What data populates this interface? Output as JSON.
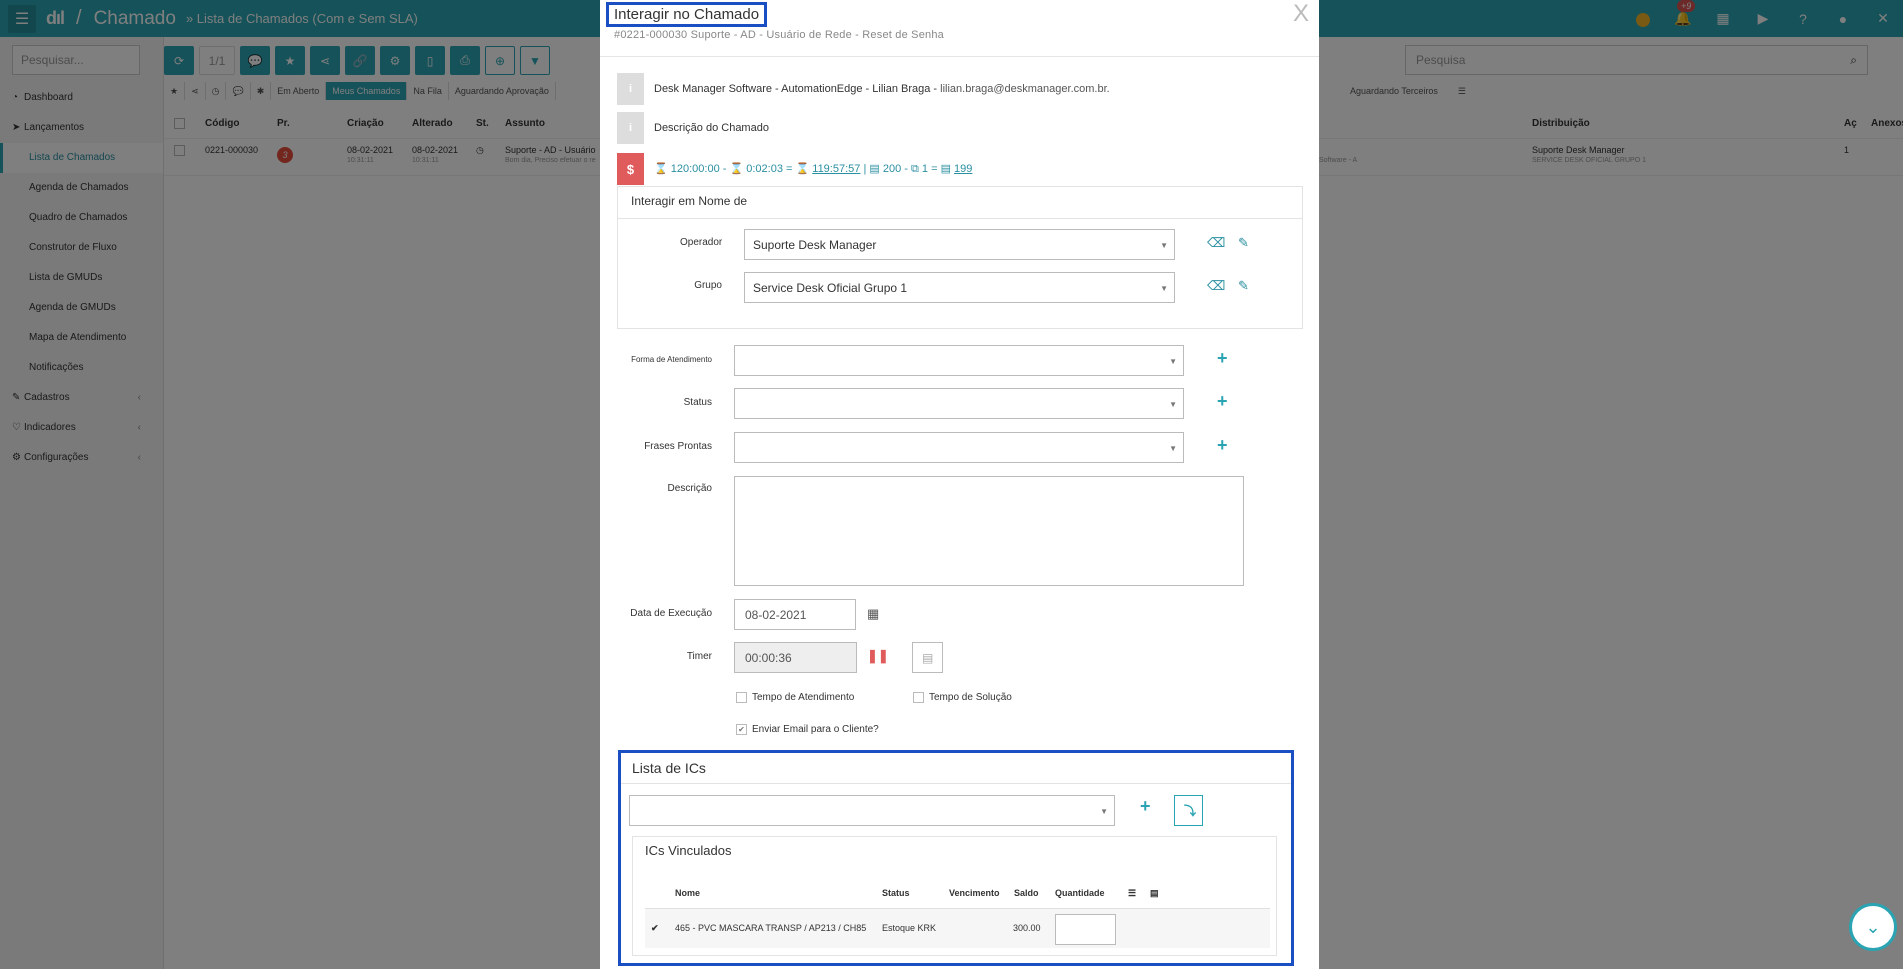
{
  "header": {
    "logo": "dıl",
    "separator": "/",
    "title": "Chamado",
    "breadcrumb": "» Lista de Chamados (Com e Sem SLA)",
    "notification_count": "+9"
  },
  "sidebar": {
    "search_placeholder": "Pesquisar...",
    "items": [
      {
        "label": "Dashboard"
      },
      {
        "label": "Lançamentos"
      },
      {
        "label": "Lista de Chamados"
      },
      {
        "label": "Agenda de Chamados"
      },
      {
        "label": "Quadro de Chamados"
      },
      {
        "label": "Construtor de Fluxo"
      },
      {
        "label": "Lista de GMUDs"
      },
      {
        "label": "Agenda de GMUDs"
      },
      {
        "label": "Mapa de Atendimento"
      },
      {
        "label": "Notificações"
      },
      {
        "label": "Cadastros"
      },
      {
        "label": "Indicadores"
      },
      {
        "label": "Configurações"
      }
    ]
  },
  "toolbar": {
    "counter": "1/1",
    "search_placeholder": "Pesquisa"
  },
  "filter_tabs": [
    "Em Aberto",
    "Meus Chamados",
    "Na Fila",
    "Aguardando Aprovação"
  ],
  "filter_tab_right": "Aguardando Terceiros",
  "table": {
    "headers": {
      "codigo": "Código",
      "pr": "Pr.",
      "criacao": "Criação",
      "alterado": "Alterado",
      "st": "St.",
      "assunto": "Assunto",
      "distribuicao": "Distribuição",
      "ac": "Aç",
      "anexos": "Anexos"
    },
    "row": {
      "codigo": "0221-000030",
      "pr": "3",
      "criacao_date": "08-02-2021",
      "criacao_time": "10:31:11",
      "alterado_date": "08-02-2021",
      "alterado_time": "10:31:11",
      "assunto": "Suporte - AD - Usuário",
      "assunto_preview": "Bom dia, Preciso efetuar o re",
      "cliente_preview": "Software - A",
      "distribuicao": "Suporte Desk Manager",
      "distribuicao_grupo": "SERVICE DESK OFICIAL GRUPO 1",
      "ac": "1"
    }
  },
  "modal": {
    "title": "Interagir no Chamado",
    "subtitle": "#0221-000030 Suporte - AD - Usuário de Rede - Reset de Senha",
    "close": "X",
    "requester": "Desk Manager Software - AutomationEdge - Lilian Braga",
    "requester_email": "lilian.braga@deskmanager.com.br.",
    "description_label": "Descrição do Chamado",
    "sla": {
      "total": "120:00:00",
      "elapsed": "0:02:03",
      "remaining": "119:57:57",
      "docs": "200",
      "copies": "1",
      "result": "199"
    },
    "interact_as": {
      "title": "Interagir em Nome de",
      "operador_label": "Operador",
      "operador_value": "Suporte Desk Manager",
      "grupo_label": "Grupo",
      "grupo_value": "Service Desk Oficial Grupo 1"
    },
    "form": {
      "forma_label": "Forma de Atendimento",
      "status_label": "Status",
      "frases_label": "Frases Prontas",
      "descricao_label": "Descrição",
      "data_label": "Data de Execução",
      "data_value": "08-02-2021",
      "timer_label": "Timer",
      "timer_value": "00:00:36",
      "tempo_atendimento": "Tempo de Atendimento",
      "tempo_solucao": "Tempo de Solução",
      "enviar_email": "Enviar Email para o Cliente?"
    },
    "ics": {
      "title": "Lista de ICs",
      "linked_title": "ICs Vinculados",
      "headers": {
        "nome": "Nome",
        "status": "Status",
        "vencimento": "Vencimento",
        "saldo": "Saldo",
        "quantidade": "Quantidade"
      },
      "row": {
        "nome": "465 - PVC MASCARA TRANSP / AP213 / CH85",
        "status": "Estoque KRK",
        "vencimento": "",
        "saldo": "300.00",
        "quantidade": ""
      }
    }
  }
}
